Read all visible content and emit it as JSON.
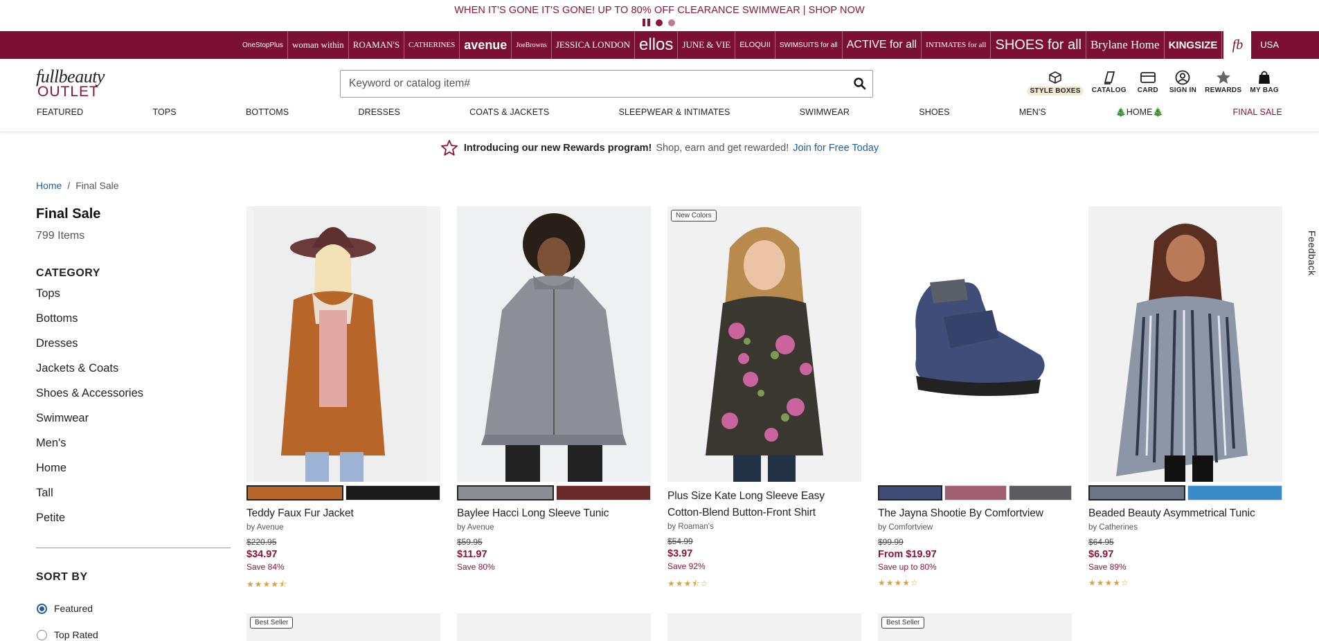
{
  "promo": {
    "message": "WHEN IT'S GONE IT'S GONE! UP TO 80% OFF CLEARANCE SWIMWEAR",
    "separator": "|",
    "cta": "SHOP NOW"
  },
  "brandbar": {
    "brands": [
      "OneStopPlus",
      "woman within",
      "ROAMAN'S",
      "CATHERINES",
      "avenue",
      "JoeBrowns",
      "JESSICA LONDON",
      "ellos",
      "JUNE & VIE",
      "ELOQUII",
      "SWIMSUITS for all",
      "ACTIVE for all",
      "INTIMATES for all",
      "SHOES for all",
      "Brylane Home",
      "KINGSIZE"
    ],
    "active_brand": "fb",
    "country": "USA"
  },
  "header": {
    "logo_line1": "fullbeauty",
    "logo_line2": "OUTLET",
    "search_placeholder": "Keyword or catalog item#",
    "utilities": [
      {
        "label": "STYLE BOXES",
        "icon": "box-icon"
      },
      {
        "label": "CATALOG",
        "icon": "catalog-icon"
      },
      {
        "label": "CARD",
        "icon": "card-icon"
      },
      {
        "label": "SIGN IN",
        "icon": "user-icon"
      },
      {
        "label": "REWARDS",
        "icon": "star-icon"
      },
      {
        "label": "MY BAG",
        "icon": "bag-icon"
      }
    ],
    "nav": [
      "FEATURED",
      "TOPS",
      "BOTTOMS",
      "DRESSES",
      "COATS & JACKETS",
      "SLEEPWEAR & INTIMATES",
      "SWIMWEAR",
      "SHOES",
      "MEN'S",
      "🎄HOME🎄",
      "FINAL SALE"
    ]
  },
  "rewards": {
    "headline": "Introducing our new Rewards program!",
    "subtext": "Shop, earn and get rewarded!",
    "link": "Join for Free Today"
  },
  "breadcrumb": {
    "home": "Home",
    "separator": "/",
    "current": "Final Sale"
  },
  "listing": {
    "title": "Final Sale",
    "count": "799 Items"
  },
  "sidebar": {
    "category_heading": "CATEGORY",
    "categories": [
      "Tops",
      "Bottoms",
      "Dresses",
      "Jackets & Coats",
      "Shoes & Accessories",
      "Swimwear",
      "Men's",
      "Home",
      "Tall",
      "Petite"
    ],
    "sort_heading": "SORT BY",
    "sort_options": [
      {
        "label": "Featured",
        "selected": true
      },
      {
        "label": "Top Rated",
        "selected": false
      }
    ]
  },
  "feedback_label": "Feedback",
  "products": [
    {
      "name": "Teddy Faux Fur Jacket",
      "brand": "by Avenue",
      "was": "$220.95",
      "now": "$34.97",
      "save": "Save 84%",
      "rating": 4.5,
      "stars": "★★★★⯪",
      "badge": "",
      "swatches": [
        "#b8652a",
        "#1a1a1a"
      ],
      "image_bg": "#f3f3f3"
    },
    {
      "name": "Baylee Hacci Long Sleeve Tunic",
      "brand": "by Avenue",
      "was": "$59.95",
      "now": "$11.97",
      "save": "Save 80%",
      "rating": 0,
      "stars": "",
      "badge": "",
      "swatches": [
        "#8a8e94",
        "#6a2a2c"
      ],
      "image_bg": "#f3f3f3"
    },
    {
      "name": "Plus Size Kate Long Sleeve Easy Cotton-Blend Button-Front Shirt",
      "brand": "by Roaman's",
      "was": "$54.99",
      "now": "$3.97",
      "save": "Save 92%",
      "rating": 3.5,
      "stars": "★★★⯪☆",
      "badge": "New Colors",
      "swatches": [],
      "image_bg": "#f3f3f3"
    },
    {
      "name": "The Jayna Shootie By Comfortview",
      "brand": "by Comfortview",
      "was": "$99.99",
      "now": "From $19.97",
      "save": "Save up to 80%",
      "rating": 4,
      "stars": "★★★★☆",
      "badge": "",
      "swatches": [
        "#3f4d78",
        "#a06072",
        "#5c5c62"
      ],
      "image_bg": "#fff"
    },
    {
      "name": "Beaded Beauty Asymmetrical Tunic",
      "brand": "by Catherines",
      "was": "$64.95",
      "now": "$6.97",
      "save": "Save 89%",
      "rating": 4,
      "stars": "★★★★☆",
      "badge": "",
      "swatches": [
        "#6a7588",
        "#3a8ac8"
      ],
      "image_bg": "#f3f3f3"
    }
  ],
  "row2_badges": [
    "Best Seller",
    "",
    "",
    "Best Seller",
    ""
  ],
  "colors": {
    "brand": "#7b1034",
    "accent": "#8a1538",
    "link": "#1f5e9a",
    "star": "#d9a240"
  }
}
